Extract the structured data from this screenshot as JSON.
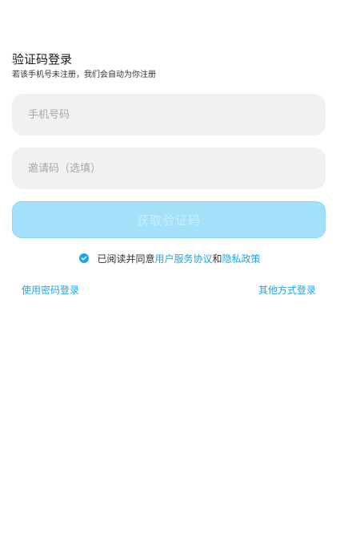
{
  "header": {
    "title": "验证码登录",
    "subtitle": "若该手机号未注册，我们会自动为你注册"
  },
  "form": {
    "phone_placeholder": "手机号码",
    "invite_placeholder": "邀请码（选填）",
    "submit_label": "获取验证码"
  },
  "agreement": {
    "checked": true,
    "prefix": "已阅读并同意",
    "service_link": "用户服务协议",
    "and": "和",
    "privacy_link": "隐私政策"
  },
  "footer": {
    "password_login": "使用密码登录",
    "other_login": "其他方式登录"
  },
  "colors": {
    "accent": "#1aa7e8",
    "button_disabled": "#a3e1fb",
    "field_bg": "#f1f1f1"
  }
}
